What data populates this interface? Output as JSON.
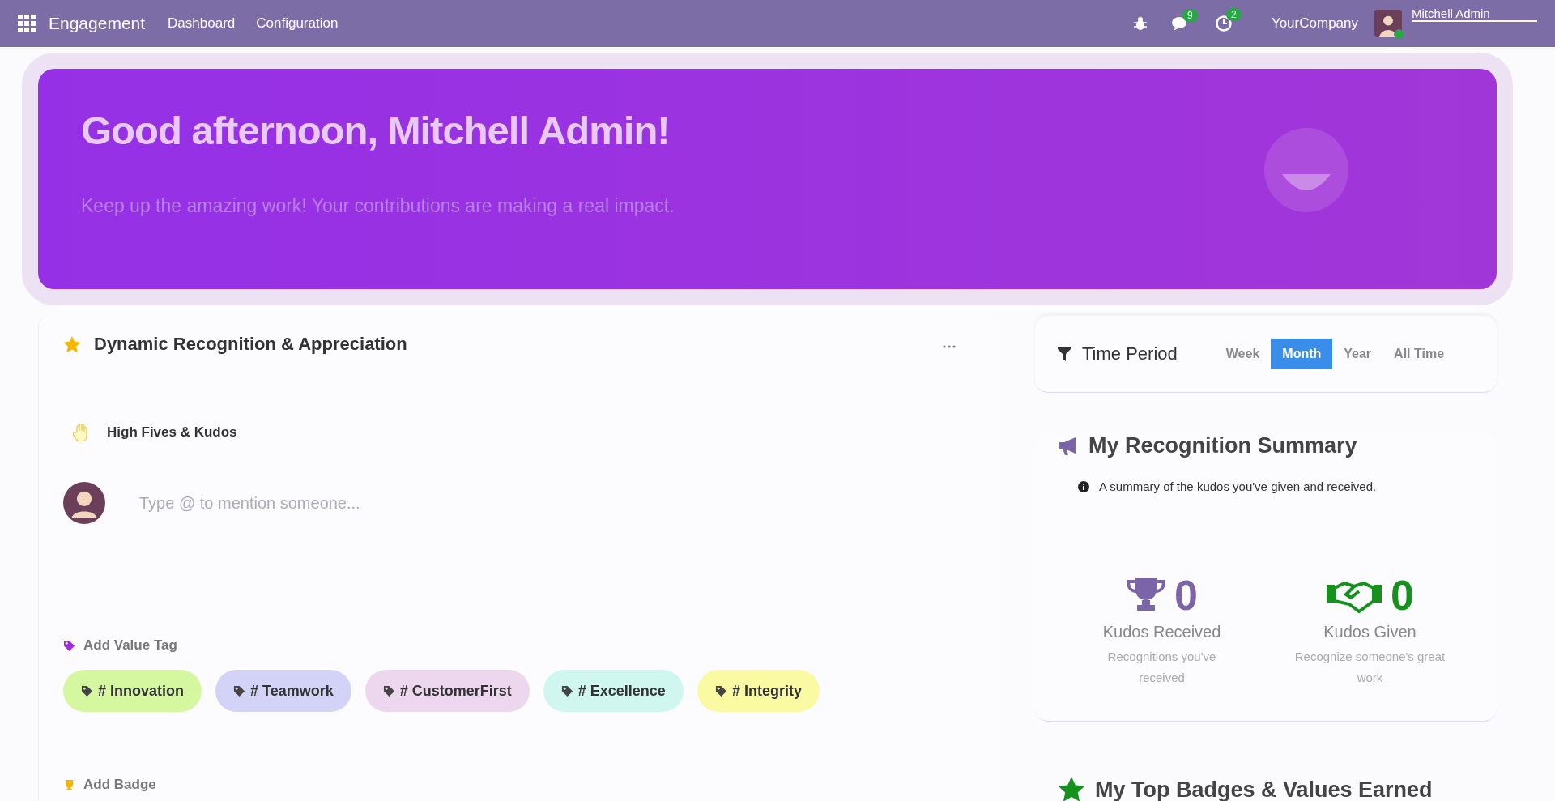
{
  "navbar": {
    "app_name": "Engagement",
    "menu": [
      "Dashboard",
      "Configuration"
    ],
    "messages_count": "9",
    "activities_count": "2",
    "company": "YourCompany",
    "user_name": "Mitchell Admin"
  },
  "banner": {
    "title": "Good afternoon, Mitchell Admin!",
    "subtitle": "Keep up the amazing work! Your contributions are making a real impact."
  },
  "recognition": {
    "title": "Dynamic Recognition & Appreciation",
    "section_label": "High Fives & Kudos",
    "input": {
      "placeholder": "Type @ to mention someone..."
    },
    "value_tag_label": "Add Value Tag",
    "tags": [
      {
        "label": "# Innovation",
        "color": "#d4f7a0"
      },
      {
        "label": "# Teamwork",
        "color": "#d3d3f7"
      },
      {
        "label": "# CustomerFirst",
        "color": "#ecd7ef"
      },
      {
        "label": "# Excellence",
        "color": "#cff7f0"
      },
      {
        "label": "# Integrity",
        "color": "#fafaa3"
      }
    ],
    "badge_label": "Add Badge"
  },
  "time_period": {
    "title": "Time Period",
    "options": [
      {
        "label": "Week",
        "selected": false
      },
      {
        "label": "Month",
        "selected": true
      },
      {
        "label": "Year",
        "selected": false
      },
      {
        "label": "All Time",
        "selected": false
      }
    ]
  },
  "summary": {
    "title": "My Recognition Summary",
    "info": "A summary of the kudos you've given and received.",
    "stats": [
      {
        "kind": "received",
        "value": "0",
        "label": "Kudos Received",
        "description": "Recognitions you've received"
      },
      {
        "kind": "given",
        "value": "0",
        "label": "Kudos Given",
        "description": "Recognize someone's great work"
      }
    ]
  },
  "top_badges": {
    "title": "My Top Badges & Values Earned"
  }
}
